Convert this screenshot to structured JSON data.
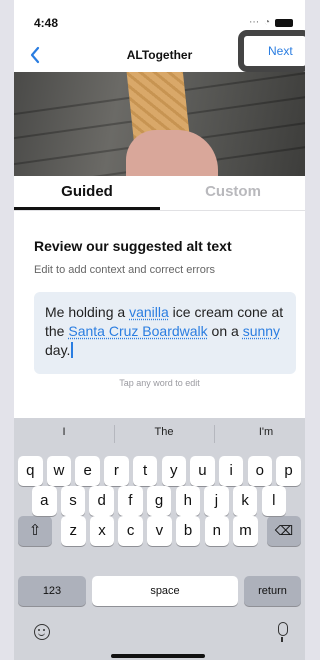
{
  "status": {
    "time": "4:48"
  },
  "nav": {
    "title": "ALTogether",
    "next_label": "Next"
  },
  "tabs": [
    {
      "label": "Guided",
      "selected": true
    },
    {
      "label": "Custom",
      "selected": false
    }
  ],
  "content": {
    "heading": "Review our suggested alt text",
    "subheading": "Edit to add context and correct errors",
    "alt_text": "Me holding a vanilla ice cream cone at the Santa Cruz Boardwalk on a sunny day.",
    "highlighted_words": [
      "vanilla",
      "Santa Cruz Boardwalk",
      "sunny"
    ],
    "hint": "Tap any word to edit"
  },
  "keyboard": {
    "suggestions": [
      "I",
      "The",
      "I'm"
    ],
    "row1": [
      "q",
      "w",
      "e",
      "r",
      "t",
      "y",
      "u",
      "i",
      "o",
      "p"
    ],
    "row2": [
      "a",
      "s",
      "d",
      "f",
      "g",
      "h",
      "j",
      "k",
      "l"
    ],
    "row3": [
      "z",
      "x",
      "c",
      "v",
      "b",
      "n",
      "m"
    ],
    "numbers_label": "123",
    "space_label": "space",
    "return_label": "return"
  },
  "colors": {
    "accent": "#2a7de1",
    "edit_bg": "#e8eef5",
    "keyboard_bg": "#d1d3d9"
  }
}
